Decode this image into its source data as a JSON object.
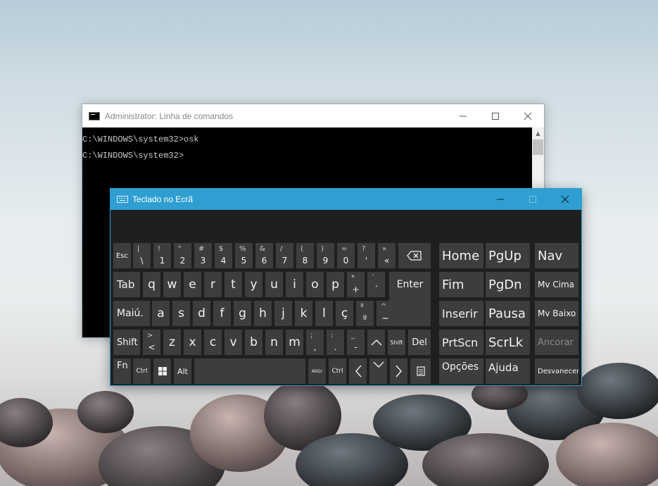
{
  "cmd": {
    "title": "Administrator: Linha de comandos",
    "lines": [
      "C:\\WINDOWS\\system32>osk",
      "C:\\WINDOWS\\system32>"
    ]
  },
  "osk": {
    "title": "Teclado no Ecrã",
    "keys": {
      "esc": "Esc",
      "n1": {
        "main": "\\",
        "shift": "|"
      },
      "n2": {
        "main": "1",
        "shift": "!"
      },
      "n3": {
        "main": "2",
        "shift": "\""
      },
      "n4": {
        "main": "3",
        "shift": "#"
      },
      "n5": {
        "main": "4",
        "shift": "$"
      },
      "n6": {
        "main": "5",
        "shift": "%"
      },
      "n7": {
        "main": "6",
        "shift": "&"
      },
      "n8": {
        "main": "7",
        "shift": "/"
      },
      "n9": {
        "main": "8",
        "shift": "("
      },
      "n10": {
        "main": "9",
        "shift": ")"
      },
      "n11": {
        "main": "0",
        "shift": "="
      },
      "n12": {
        "main": "'",
        "shift": "?"
      },
      "n13": {
        "main": "«",
        "shift": "»"
      },
      "tab": "Tab",
      "q": "q",
      "w": "w",
      "e": "e",
      "r": "r",
      "t": "t",
      "y": "y",
      "u": "u",
      "i": "i",
      "o": "o",
      "p": "p",
      "plus": {
        "main": "+",
        "shift": "*"
      },
      "acute": {
        "main": "´",
        "shift": "`"
      },
      "enter": "Enter",
      "caps": "Maiú.",
      "a": "a",
      "s": "s",
      "d": "d",
      "f": "f",
      "g": "g",
      "h": "h",
      "j": "j",
      "k": "k",
      "l": "l",
      "cced": "ç",
      "ordm": {
        "main": "º",
        "shift": "ª"
      },
      "tilde": {
        "main": "~",
        "shift": "^"
      },
      "shiftl": "Shift",
      "lt": {
        "main": "<",
        "shift": ">"
      },
      "z": "z",
      "x": "x",
      "c": "c",
      "v": "v",
      "b": "b",
      "n": "n",
      "m": "m",
      "comma": {
        "main": ",",
        "shift": ";"
      },
      "period": {
        "main": ".",
        "shift": ":"
      },
      "dash": {
        "main": "-",
        "shift": "_"
      },
      "up": "^",
      "shiftr": "Shift",
      "del": "Del",
      "fn": "Fn",
      "ctrl": "Ctrl",
      "alt": "Alt",
      "altgr": "AltGr",
      "ctrlr": "Ctrl",
      "left": "<",
      "down": "v",
      "right": ">"
    },
    "nav": {
      "home": "Home",
      "pgup": "PgUp",
      "nav": "Nav",
      "fim": "Fim",
      "pgdn": "PgDn",
      "mvcima": "Mv Cima",
      "inserir": "Inserir",
      "pausa": "Pausa",
      "mvbaixo": "Mv Baixo",
      "prtscn": "PrtScn",
      "scrlk": "ScrLk",
      "ancorar": "Ancorar",
      "opcoes": "Opções",
      "ajuda": "Ajuda",
      "desvanecer": "Desvanecer"
    }
  },
  "colors": {
    "osk_title": "#2e9fd0",
    "key_bg": "#3d3d3d",
    "osk_bg": "#1f1f1f"
  }
}
